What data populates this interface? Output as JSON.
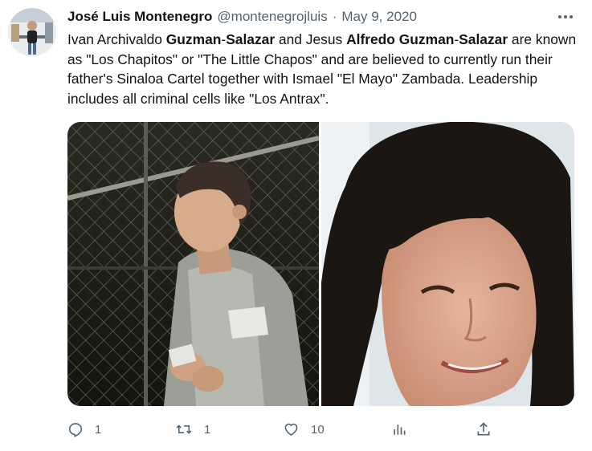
{
  "tweet": {
    "author_name": "José Luis Montenegro",
    "author_handle": "@montenegrojluis",
    "separator": "·",
    "date": "May 9, 2020",
    "body_segments": [
      {
        "text": "Ivan Archivaldo ",
        "bold": false
      },
      {
        "text": "Guzman",
        "bold": true
      },
      {
        "text": "-",
        "bold": false
      },
      {
        "text": "Salazar",
        "bold": true
      },
      {
        "text": " and Jesus ",
        "bold": false
      },
      {
        "text": "Alfredo Guzman",
        "bold": true
      },
      {
        "text": "-",
        "bold": false
      },
      {
        "text": "Salazar",
        "bold": true
      },
      {
        "text": " are known as \"Los Chapitos\" or \"The Little Chapos\" and are believed to currently run their father's Sinaloa Cartel together with Ismael \"El Mayo\" Zambada. Leadership includes all criminal cells like \"Los Antrax\".",
        "bold": false
      }
    ]
  },
  "actions": {
    "reply_count": "1",
    "retweet_count": "1",
    "like_count": "10"
  },
  "icons": {
    "avatar": "avatar-photo",
    "more": "more-icon",
    "reply": "reply-icon",
    "retweet": "retweet-icon",
    "like": "heart-icon",
    "analytics": "analytics-icon",
    "share": "share-icon"
  },
  "colors": {
    "text": "#0f1419",
    "secondary": "#536471",
    "background": "#ffffff"
  }
}
